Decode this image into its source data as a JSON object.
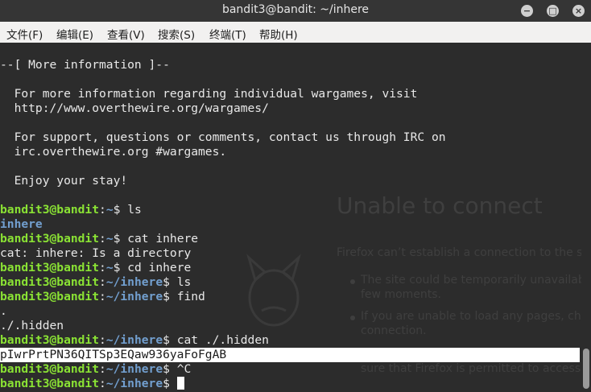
{
  "window": {
    "title": "bandit3@bandit: ~/inhere"
  },
  "menu": [
    "文件(F)",
    "编辑(E)",
    "查看(V)",
    "搜索(S)",
    "终端(T)",
    "帮助(H)"
  ],
  "controls": {
    "minimize": "−",
    "maximize": "□",
    "close": "×"
  },
  "prompt": {
    "user_host": "bandit3@bandit",
    "home": "~",
    "inhere": "~/inhere",
    "symbol": "$ "
  },
  "terminal": {
    "info_header": "--[ More information ]--",
    "info_1": "  For more information regarding individual wargames, visit",
    "info_2": "  http://www.overthewire.org/wargames/",
    "info_3": "  For support, questions or comments, contact us through IRC on",
    "info_4": "  irc.overthewire.org #wargames.",
    "info_5": "  Enjoy your stay!",
    "cmd_ls": "ls",
    "out_inhere": "inhere",
    "cmd_cat_inhere": "cat inhere",
    "out_cat_error": "cat: inhere: Is a directory",
    "cmd_cd": "cd inhere",
    "cmd_ls2": "ls",
    "cmd_find": "find",
    "out_dot": ".",
    "out_hidden": "./.hidden",
    "cmd_cat_hidden": "cat ./.hidden",
    "out_password": "pIwrPrtPN36QITSp3EQaw936yaFoFgAB",
    "cmd_ctrl_c": "^C"
  },
  "background_page": {
    "heading": "Unable to connect",
    "body": "Firefox can’t establish a connection to the serv",
    "bullet1_line1": "The site could be temporarily unavailable",
    "bullet1_line2": "few moments.",
    "bullet2_line1": "If you are unable to load any pages, check",
    "bullet2_line2": "connection.",
    "bullet3": "sure that Firefox is permitted to access th"
  }
}
